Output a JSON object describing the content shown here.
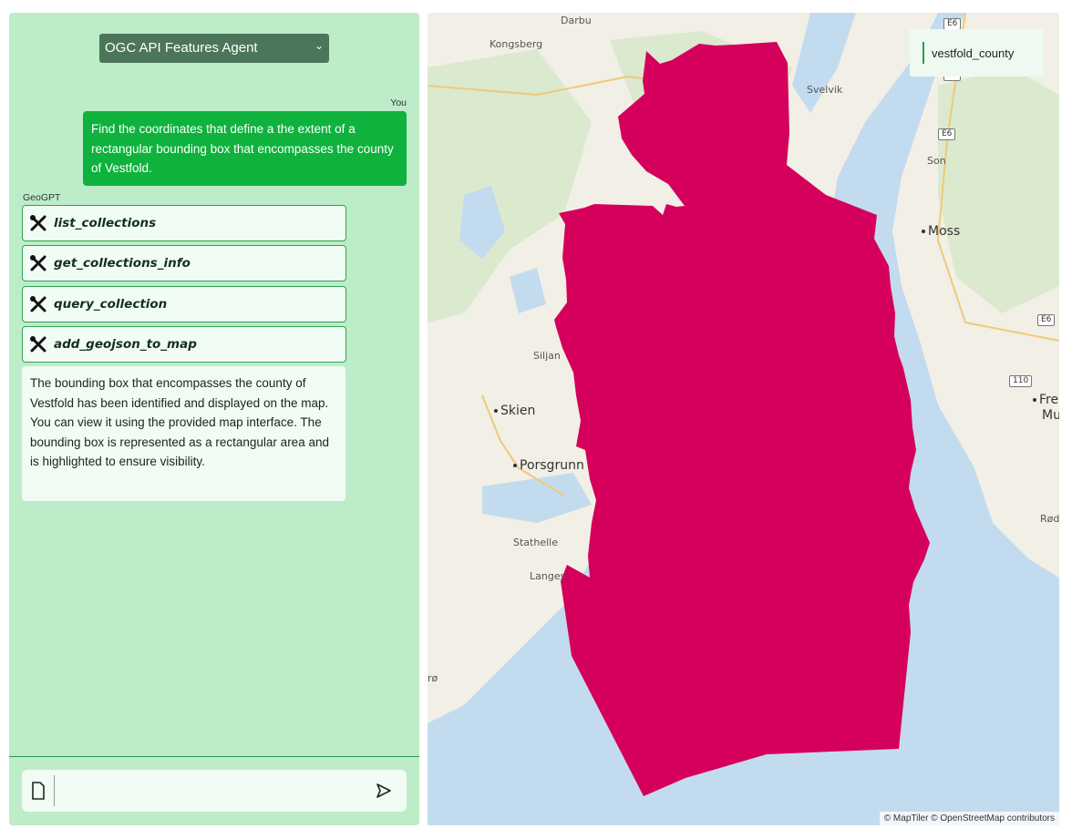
{
  "agent_selector": {
    "value": "OGC API Features Agent",
    "options": [
      "OGC API Features Agent"
    ]
  },
  "chat": {
    "user_label": "You",
    "user_message": "Find the coordinates that define a the extent of a rectangular bounding box that encompasses the county of Vestfold.",
    "assistant_label": "GeoGPT",
    "tool_calls": [
      "list_collections",
      "get_collections_info",
      "query_collection",
      "add_geojson_to_map"
    ],
    "assistant_message": "The bounding box that encompasses the county of Vestfold has been identified and displayed on the map. You can view it using the provided map interface. The bounding box is represented as a rectangular area and is highlighted to ensure visibility."
  },
  "input": {
    "value": "",
    "placeholder": ""
  },
  "map": {
    "layer_name": "vestfold_county",
    "polygon_color": "#d4005c",
    "water_color": "#c3dbef",
    "land_color": "#f2efe6",
    "attribution": "© MapTiler © OpenStreetMap contributors",
    "places": [
      "Darbu",
      "Kongsberg",
      "Svelvik",
      "Son",
      "Siljan",
      "Stathelle",
      "Langes",
      "Rød",
      "rø"
    ],
    "cities": [
      "Moss",
      "Skien",
      "Porsgrunn",
      "Fre",
      "Mu"
    ],
    "road_shields": [
      "E6",
      "E6",
      "E6",
      "E6",
      "110"
    ]
  },
  "icons": {
    "tool": "wrench-screwdriver-icon",
    "attach": "file-icon",
    "send": "send-icon",
    "select": "chevron-down-icon"
  },
  "colors": {
    "panel": "#bdecc9",
    "user_bubble": "#0eb23d",
    "tool_border": "#30a34f",
    "select_bg": "#4c7659"
  }
}
